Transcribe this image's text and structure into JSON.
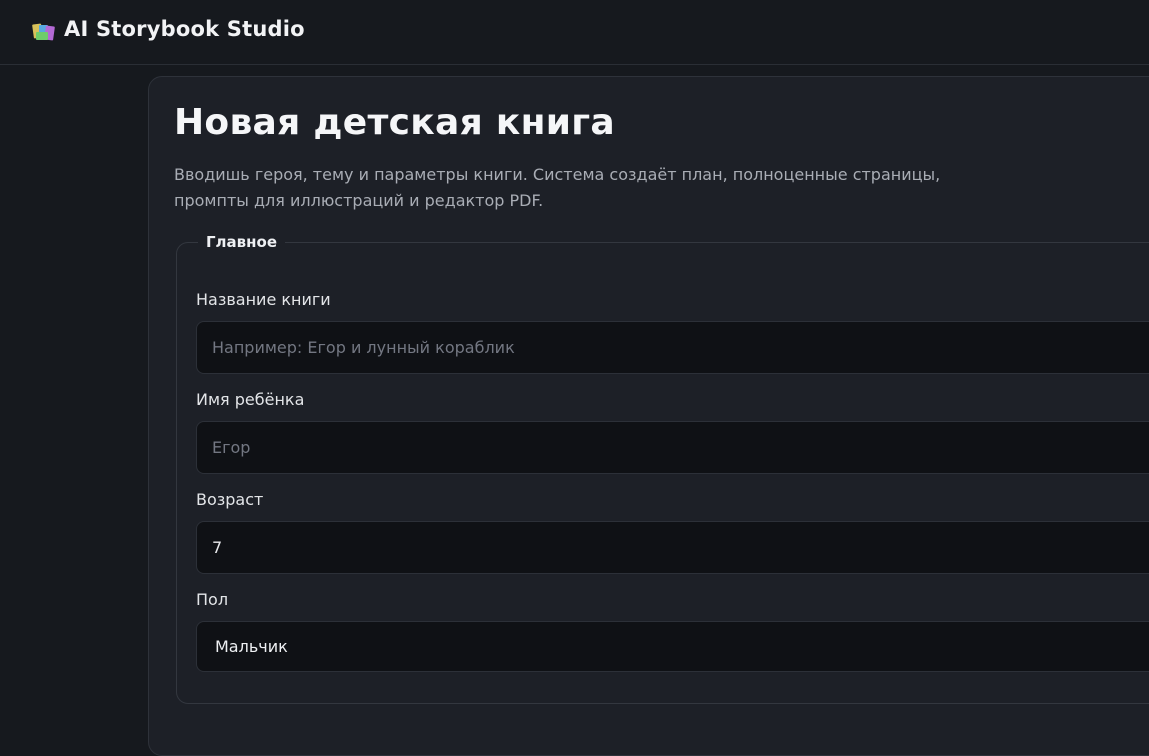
{
  "app": {
    "title": "AI Storybook Studio"
  },
  "page": {
    "title": "Новая детская книга",
    "description": "Вводишь героя, тему и параметры книги. Система создаёт план, полноценные страницы, промпты для иллюстраций и редактор PDF."
  },
  "section": {
    "legend": "Главное"
  },
  "fields": {
    "book_title": {
      "label": "Название книги",
      "value": "",
      "placeholder": "Например: Егор и лунный кораблик"
    },
    "child_name": {
      "label": "Имя ребёнка",
      "value": "",
      "placeholder": "Егор"
    },
    "age": {
      "label": "Возраст",
      "value": "7"
    },
    "gender": {
      "label": "Пол",
      "selected": "Мальчик"
    }
  },
  "colors": {
    "background": "#16191e",
    "card": "#1d2027",
    "input": "#0f1115"
  }
}
